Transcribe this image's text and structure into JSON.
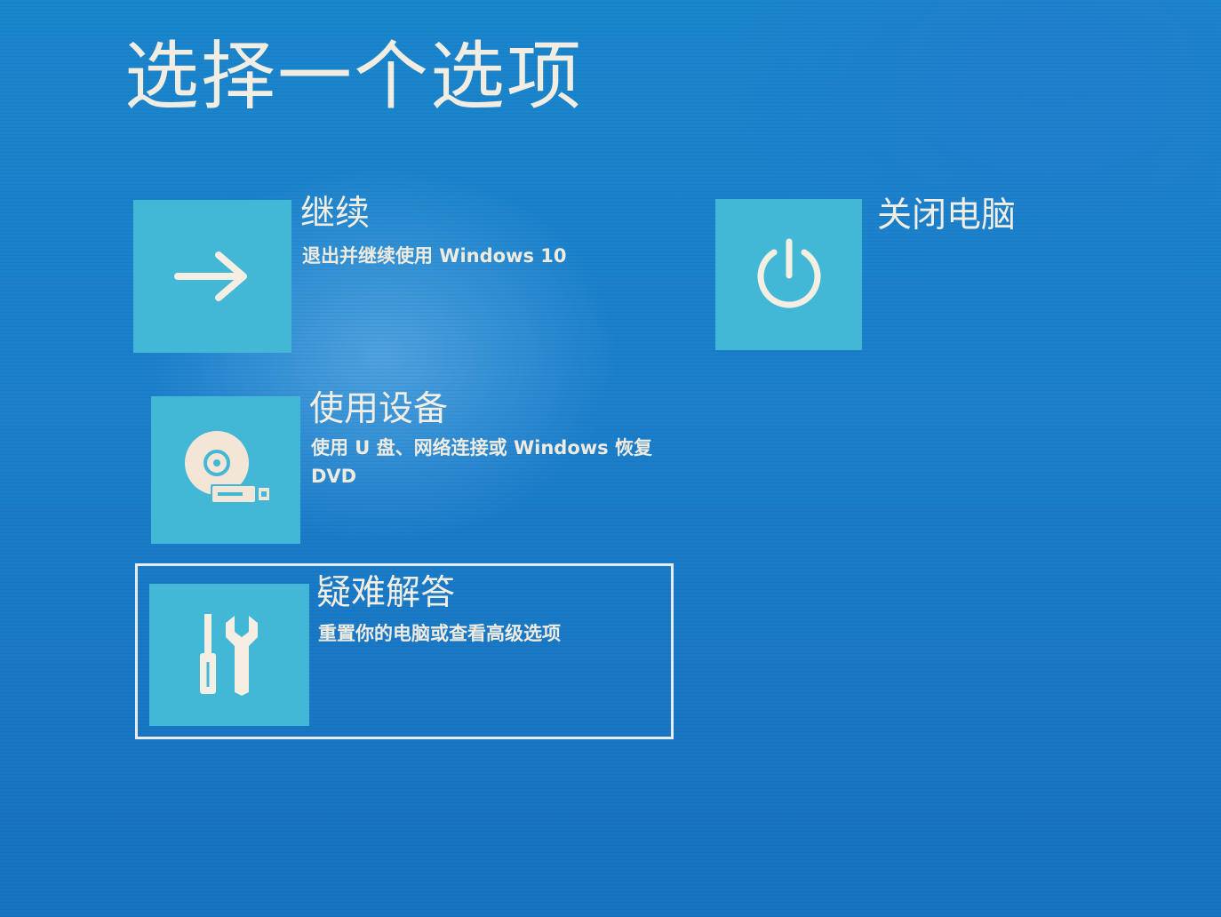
{
  "page": {
    "title": "选择一个选项"
  },
  "options": [
    {
      "id": "continue",
      "title": "继续",
      "description": "退出并继续使用 Windows 10",
      "icon": "arrow-right-icon"
    },
    {
      "id": "use-device",
      "title": "使用设备",
      "description_line1": "使用 U 盘、网络连接或 Windows 恢复",
      "description_line2": "DVD",
      "icon": "disc-drive-icon"
    },
    {
      "id": "troubleshoot",
      "title": "疑难解答",
      "description": "重置你的电脑或查看高级选项",
      "icon": "tools-icon",
      "selected": true
    },
    {
      "id": "shutdown",
      "title": "关闭电脑",
      "icon": "power-icon"
    }
  ],
  "colors": {
    "background": "#1a7fc8",
    "tile": "#43b7d6",
    "text": "#f2eee3",
    "focus_border": "#e9ecef"
  }
}
